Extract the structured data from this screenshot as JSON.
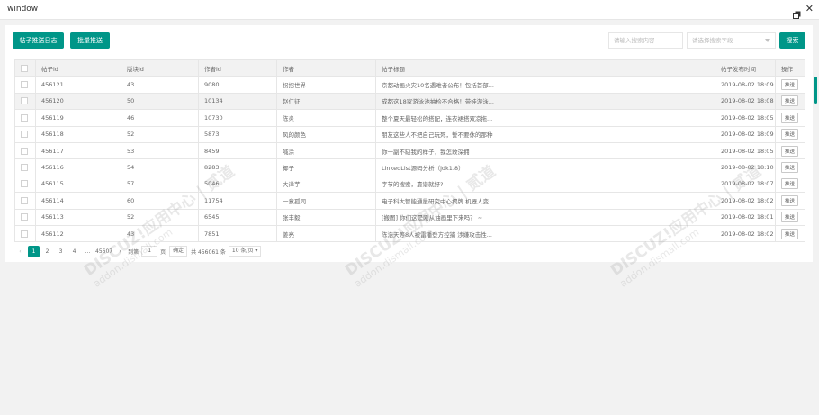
{
  "window": {
    "title": "window"
  },
  "toolbar": {
    "log_button": "帖子推送日志",
    "batch_button": "批量推送",
    "search_placeholder": "请输入搜索内容",
    "field_placeholder": "请选择搜索字段",
    "search_button": "搜索"
  },
  "table": {
    "columns": [
      "帖子id",
      "版块id",
      "作者id",
      "作者",
      "帖子标题",
      "帖子发布时间",
      "操作"
    ],
    "push_label": "推送",
    "rows": [
      {
        "tid": "456121",
        "fid": "43",
        "uid": "9080",
        "author": "拐拐世界",
        "title": "京都动画火灾10名遇难者公布！包括首部...",
        "time": "2019-08-02 18:09"
      },
      {
        "tid": "456120",
        "fid": "50",
        "uid": "10134",
        "author": "赵仁征",
        "title": "成都这18家游泳池抽检不合格！带娃游泳...",
        "time": "2019-08-02 18:08"
      },
      {
        "tid": "456119",
        "fid": "46",
        "uid": "10730",
        "author": "陈炎",
        "title": "整个夏天最轻松的搭配，连衣裙搭双凉拖...",
        "time": "2019-08-02 18:05"
      },
      {
        "tid": "456118",
        "fid": "52",
        "uid": "5873",
        "author": "风的颜色",
        "title": "朋友这些人不把自己玩死，誓不要休的那种",
        "time": "2019-08-02 18:09"
      },
      {
        "tid": "456117",
        "fid": "53",
        "uid": "8459",
        "author": "喊涂",
        "title": "你一副不缺我的样子，我怎敢深拥",
        "time": "2019-08-02 18:05"
      },
      {
        "tid": "456116",
        "fid": "54",
        "uid": "8283",
        "author": "椰子",
        "title": "LinkedList源码分析（jdk1.8）",
        "time": "2019-08-02 18:10"
      },
      {
        "tid": "456115",
        "fid": "57",
        "uid": "5046",
        "author": "大洋芋",
        "title": "字节的搜索，靠谱就好?",
        "time": "2019-08-02 18:07"
      },
      {
        "tid": "456114",
        "fid": "60",
        "uid": "11754",
        "author": "一意孤同",
        "title": "电子科大智能通量研究中心揭牌 机器人变...",
        "time": "2019-08-02 18:02"
      },
      {
        "tid": "456113",
        "fid": "52",
        "uid": "6545",
        "author": "张丰毅",
        "title": "[搬图] 你们这是刚从油画里下来吗？ ~",
        "time": "2019-08-02 18:01"
      },
      {
        "tid": "456112",
        "fid": "43",
        "uid": "7851",
        "author": "姜亮",
        "title": "陈浩天等8人被雷潘登方控捕 涉嫌攻击性...",
        "time": "2019-08-02 18:02"
      }
    ]
  },
  "pager": {
    "pages": [
      "1",
      "2",
      "3",
      "4"
    ],
    "ellipsis": "...",
    "last": "45607",
    "goto_prefix": "到第",
    "goto_value": "1",
    "goto_suffix": "页",
    "confirm": "确定",
    "total": "共 456061 条",
    "size": "10 条/页"
  },
  "watermark": {
    "main": "DISCUZ!应用中心 | 贰道",
    "sub": "addon.dismall.com"
  }
}
